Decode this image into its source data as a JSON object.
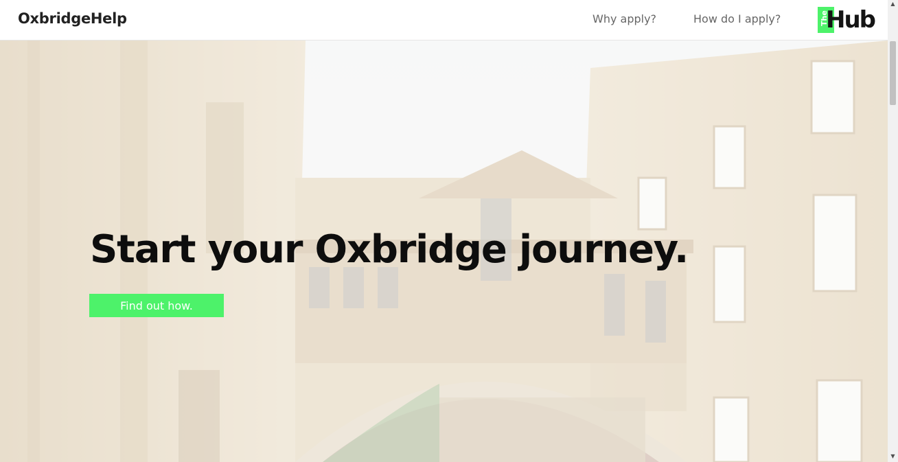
{
  "header": {
    "brand": "OxbridgeHelp",
    "nav": [
      {
        "label": "Why apply?"
      },
      {
        "label": "How do I apply?"
      }
    ],
    "logo": {
      "prefix": "The",
      "word": "Hub",
      "accent_color": "#4df26a"
    }
  },
  "hero": {
    "headline": "Start your Oxbridge journey.",
    "cta_label": "Find out how.",
    "cta_color": "#4df26a",
    "background": "photo of a stone arched bridge between old college buildings"
  },
  "scrollbar": {
    "up_icon": "triangle-up-icon",
    "down_icon": "triangle-down-icon"
  }
}
